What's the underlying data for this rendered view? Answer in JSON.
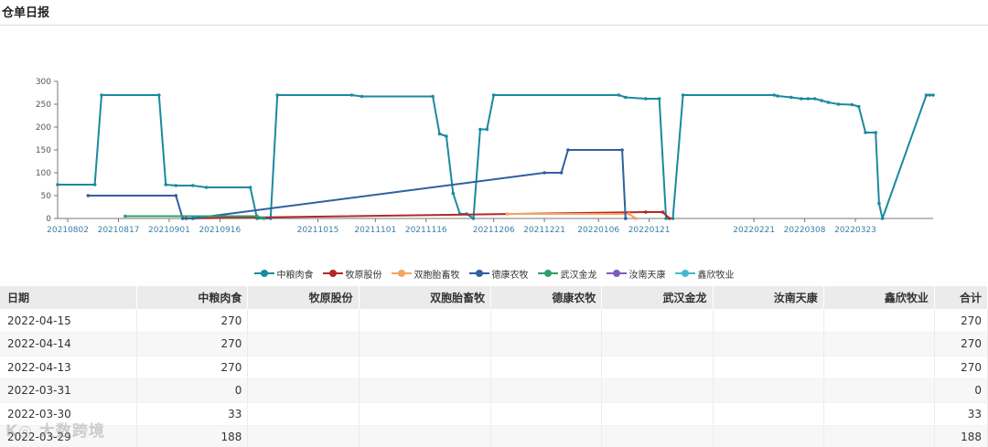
{
  "page": {
    "title": "仓单日报",
    "watermark": "K◎ 大数跨境"
  },
  "colors": {
    "中粮肉食": "#1a8a9e",
    "牧原股份": "#b3282a",
    "双胞胎畜牧": "#f5a45c",
    "德康农牧": "#2f60a0",
    "武汉金龙": "#2ea06a",
    "汝南天康": "#7e5cc4",
    "鑫欣牧业": "#47b8cc"
  },
  "chart_data": {
    "type": "line",
    "y_ticks": [
      0,
      50,
      100,
      150,
      200,
      250,
      300
    ],
    "ylim": [
      0,
      300
    ],
    "x_range": [
      "2021-07-30",
      "2022-04-15"
    ],
    "x_tick_labels": [
      "20210802",
      "20210817",
      "20210901",
      "20210916",
      "20211015",
      "20211101",
      "20211116",
      "20211206",
      "20211221",
      "20220106",
      "20220121",
      "20220221",
      "20220308",
      "20220323"
    ],
    "x_tick_dates": [
      "2021-08-02",
      "2021-08-17",
      "2021-09-01",
      "2021-09-16",
      "2021-10-15",
      "2021-11-01",
      "2021-11-16",
      "2021-12-06",
      "2021-12-21",
      "2022-01-06",
      "2022-01-21",
      "2022-02-21",
      "2022-03-08",
      "2022-03-23"
    ],
    "series": [
      {
        "name": "中粮肉食",
        "points": [
          [
            "2021-07-30",
            74
          ],
          [
            "2021-08-10",
            74
          ],
          [
            "2021-08-12",
            270
          ],
          [
            "2021-08-29",
            270
          ],
          [
            "2021-08-31",
            74
          ],
          [
            "2021-09-03",
            72
          ],
          [
            "2021-09-08",
            72
          ],
          [
            "2021-09-12",
            68
          ],
          [
            "2021-09-25",
            68
          ],
          [
            "2021-09-27",
            0
          ],
          [
            "2021-10-01",
            0
          ],
          [
            "2021-10-03",
            270
          ],
          [
            "2021-10-25",
            270
          ],
          [
            "2021-10-28",
            267
          ],
          [
            "2021-11-18",
            267
          ],
          [
            "2021-11-20",
            185
          ],
          [
            "2021-11-22",
            180
          ],
          [
            "2021-11-24",
            55
          ],
          [
            "2021-11-26",
            10
          ],
          [
            "2021-11-28",
            10
          ],
          [
            "2021-11-30",
            0
          ],
          [
            "2021-12-02",
            195
          ],
          [
            "2021-12-04",
            195
          ],
          [
            "2021-12-06",
            270
          ],
          [
            "2022-01-12",
            270
          ],
          [
            "2022-01-14",
            265
          ],
          [
            "2022-01-20",
            262
          ],
          [
            "2022-01-24",
            262
          ],
          [
            "2022-01-26",
            0
          ],
          [
            "2022-01-28",
            0
          ],
          [
            "2022-01-31",
            270
          ],
          [
            "2022-02-27",
            270
          ],
          [
            "2022-02-28",
            268
          ],
          [
            "2022-03-04",
            265
          ],
          [
            "2022-03-07",
            262
          ],
          [
            "2022-03-09",
            262
          ],
          [
            "2022-03-11",
            262
          ],
          [
            "2022-03-13",
            258
          ],
          [
            "2022-03-15",
            254
          ],
          [
            "2022-03-18",
            250
          ],
          [
            "2022-03-22",
            249
          ],
          [
            "2022-03-24",
            245
          ],
          [
            "2022-03-26",
            188
          ],
          [
            "2022-03-29",
            188
          ],
          [
            "2022-03-30",
            33
          ],
          [
            "2022-03-31",
            0
          ],
          [
            "2022-04-13",
            270
          ],
          [
            "2022-04-14",
            270
          ],
          [
            "2022-04-15",
            270
          ]
        ]
      },
      {
        "name": "牧原股份",
        "points": [
          [
            "2021-09-06",
            0
          ],
          [
            "2022-01-20",
            14
          ],
          [
            "2022-01-25",
            14
          ],
          [
            "2022-01-27",
            0
          ]
        ]
      },
      {
        "name": "双胞胎畜牧",
        "points": [
          [
            "2021-12-10",
            10
          ],
          [
            "2022-01-15",
            10
          ],
          [
            "2022-01-17",
            0
          ]
        ]
      },
      {
        "name": "德康农牧",
        "points": [
          [
            "2021-08-08",
            50
          ],
          [
            "2021-09-03",
            50
          ],
          [
            "2021-09-05",
            0
          ],
          [
            "2021-09-08",
            0
          ],
          [
            "2021-12-21",
            100
          ],
          [
            "2021-12-26",
            100
          ],
          [
            "2021-12-28",
            150
          ],
          [
            "2022-01-13",
            150
          ],
          [
            "2022-01-14",
            0
          ]
        ]
      },
      {
        "name": "武汉金龙",
        "points": [
          [
            "2021-08-19",
            5
          ],
          [
            "2021-09-27",
            5
          ],
          [
            "2021-09-29",
            0
          ]
        ]
      },
      {
        "name": "汝南天康",
        "points": []
      },
      {
        "name": "鑫欣牧业",
        "points": []
      }
    ]
  },
  "table": {
    "headers": [
      "日期",
      "中粮肉食",
      "牧原股份",
      "双胞胎畜牧",
      "德康农牧",
      "武汉金龙",
      "汝南天康",
      "鑫欣牧业",
      "合计"
    ],
    "rows": [
      [
        "2022-04-15",
        "270",
        "",
        "",
        "",
        "",
        "",
        "",
        "270"
      ],
      [
        "2022-04-14",
        "270",
        "",
        "",
        "",
        "",
        "",
        "",
        "270"
      ],
      [
        "2022-04-13",
        "270",
        "",
        "",
        "",
        "",
        "",
        "",
        "270"
      ],
      [
        "2022-03-31",
        "0",
        "",
        "",
        "",
        "",
        "",
        "",
        "0"
      ],
      [
        "2022-03-30",
        "33",
        "",
        "",
        "",
        "",
        "",
        "",
        "33"
      ],
      [
        "2022-03-29",
        "188",
        "",
        "",
        "",
        "",
        "",
        "",
        "188"
      ]
    ]
  }
}
